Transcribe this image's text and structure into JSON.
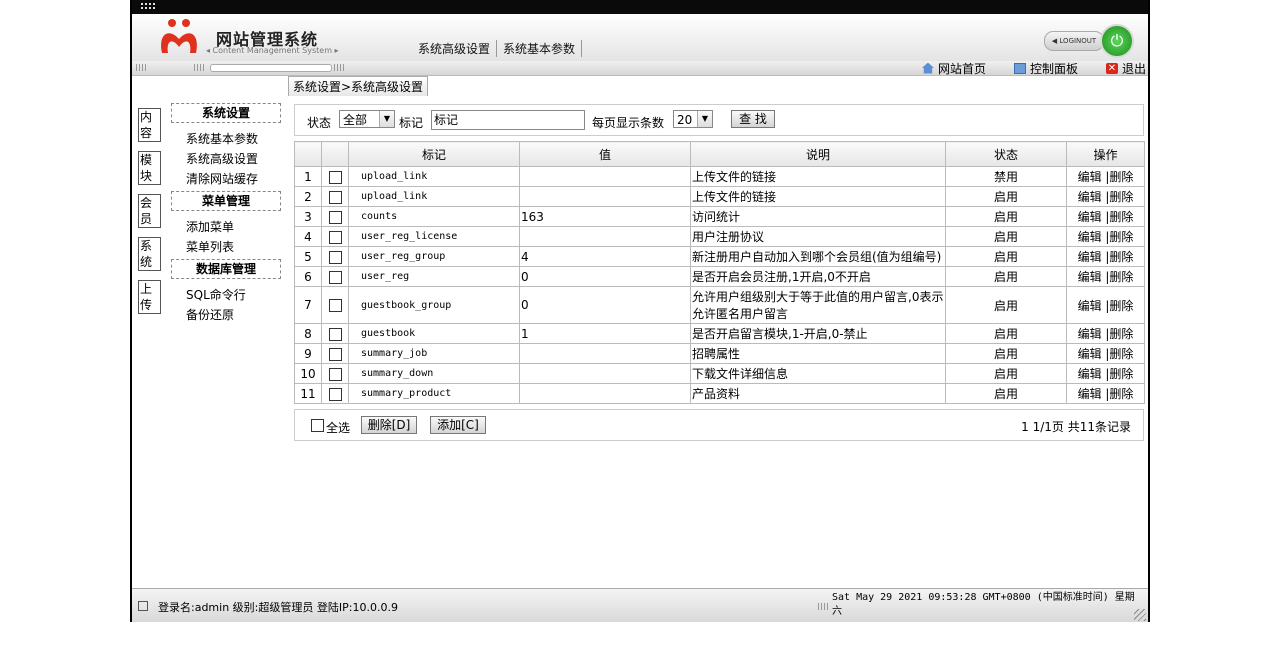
{
  "header": {
    "brand_title": "网站管理系统",
    "brand_subtitle": "◂ Content Management System ▸",
    "nav": [
      "系统高级设置",
      "系统基本参数"
    ],
    "logout_label": "◀ LOGINOUT"
  },
  "toolbar": {
    "links": [
      {
        "label": "网站首页",
        "icon": "home-icon"
      },
      {
        "label": "控制面板",
        "icon": "control-panel-icon"
      },
      {
        "label": "退出",
        "icon": "exit-icon"
      }
    ]
  },
  "breadcrumb": "系统设置>系统高级设置",
  "leftstrip": [
    "内容",
    "模块",
    "会员",
    "系统",
    "上传"
  ],
  "sidebar": {
    "sections": [
      {
        "title": "系统设置",
        "items": [
          "系统基本参数",
          "系统高级设置",
          "清除网站缓存"
        ]
      },
      {
        "title": "菜单管理",
        "items": [
          "添加菜单",
          "菜单列表"
        ]
      },
      {
        "title": "数据库管理",
        "items": [
          "SQL命令行",
          "备份还原"
        ]
      }
    ]
  },
  "filter": {
    "status_label": "状态",
    "status_value": "全部",
    "tag_label": "标记",
    "tag_value": "标记",
    "per_page_label": "每页显示条数",
    "per_page_value": "20",
    "search_button": "查 找"
  },
  "table": {
    "headers": [
      "",
      "",
      "标记",
      "值",
      "说明",
      "状态",
      "操作"
    ],
    "rows": [
      {
        "no": "1",
        "tag": "upload_link",
        "value": "",
        "desc": "上传文件的链接",
        "status": "禁用"
      },
      {
        "no": "2",
        "tag": "upload_link",
        "value": "",
        "desc": "上传文件的链接",
        "status": "启用"
      },
      {
        "no": "3",
        "tag": "counts",
        "value": "163",
        "desc": "访问统计",
        "status": "启用"
      },
      {
        "no": "4",
        "tag": "user_reg_license",
        "value": "",
        "desc": "用户注册协议",
        "status": "启用"
      },
      {
        "no": "5",
        "tag": "user_reg_group",
        "value": "4",
        "desc": "新注册用户自动加入到哪个会员组(值为组编号)",
        "status": "启用"
      },
      {
        "no": "6",
        "tag": "user_reg",
        "value": "0",
        "desc": "是否开启会员注册,1开启,0不开启",
        "status": "启用"
      },
      {
        "no": "7",
        "tag": "guestbook_group",
        "value": "0",
        "desc": "允许用户组级别大于等于此值的用户留言,0表示允许匿名用户留言",
        "status": "启用"
      },
      {
        "no": "8",
        "tag": "guestbook",
        "value": "1",
        "desc": "是否开启留言模块,1-开启,0-禁止",
        "status": "启用"
      },
      {
        "no": "9",
        "tag": "summary_job",
        "value": "",
        "desc": "招聘属性",
        "status": "启用"
      },
      {
        "no": "10",
        "tag": "summary_down",
        "value": "",
        "desc": "下载文件详细信息",
        "status": "启用"
      },
      {
        "no": "11",
        "tag": "summary_product",
        "value": "",
        "desc": "产品资料",
        "status": "启用"
      }
    ],
    "action_label": "编辑 |删除"
  },
  "footer": {
    "select_all": "全选",
    "delete_button": "删除[D]",
    "add_button": "添加[C]",
    "pagination": "1 1/1页 共11条记录"
  },
  "status": {
    "login_info": "登录名:admin  级别:超级管理员  登陆IP:10.0.0.9",
    "datetime": "Sat May 29 2021 09:53:28 GMT+0800 (中国标准时间) 星期六"
  }
}
